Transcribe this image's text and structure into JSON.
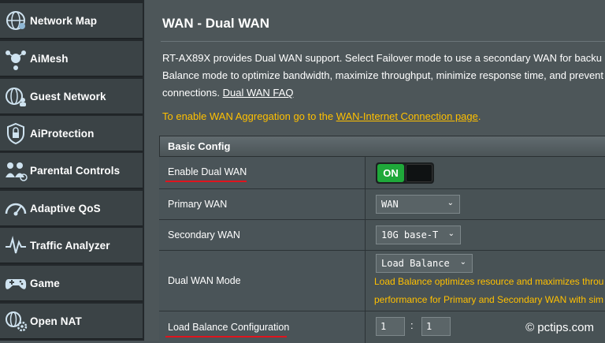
{
  "sidebar": {
    "items": [
      {
        "label": "Network Map",
        "icon": "globe-network-icon"
      },
      {
        "label": "AiMesh",
        "icon": "mesh-router-icon"
      },
      {
        "label": "Guest Network",
        "icon": "globe-guest-icon"
      },
      {
        "label": "AiProtection",
        "icon": "shield-lock-icon"
      },
      {
        "label": "Parental Controls",
        "icon": "family-icon"
      },
      {
        "label": "Adaptive QoS",
        "icon": "speedometer-icon"
      },
      {
        "label": "Traffic Analyzer",
        "icon": "pulse-graph-icon"
      },
      {
        "label": "Game",
        "icon": "gamepad-icon"
      },
      {
        "label": "Open NAT",
        "icon": "globe-gear-icon"
      }
    ]
  },
  "page": {
    "title": "WAN - Dual WAN",
    "desc_line1": "RT-AX89X provides Dual WAN support. Select Failover mode to use a secondary WAN for backu",
    "desc_line2": "Balance mode to optimize bandwidth, maximize throughput, minimize response time, and prevent",
    "desc_line3_pre": "connections.",
    "desc_link": "Dual WAN FAQ",
    "warn_pre": "To enable WAN Aggregation go to the",
    "warn_link": "WAN-Internet Connection page",
    "warn_post": "."
  },
  "config": {
    "header": "Basic Config",
    "enable_label": "Enable Dual WAN",
    "enable_state": "ON",
    "primary_label": "Primary WAN",
    "primary_value": "WAN",
    "secondary_label": "Secondary WAN",
    "secondary_value": "10G base-T",
    "mode_label": "Dual WAN Mode",
    "mode_value": "Load Balance",
    "mode_note1": "Load Balance optimizes resource and maximizes throu",
    "mode_note2": "performance for Primary and Secondary WAN with sim",
    "lb_label": "Load Balance Configuration",
    "lb_value1": "1",
    "lb_sep": ":",
    "lb_value2": "1"
  },
  "watermark": "© pctips.com",
  "colors": {
    "accent_red": "#e0141e",
    "note_yellow": "#ffc000",
    "toggle_green": "#1fa83a"
  }
}
